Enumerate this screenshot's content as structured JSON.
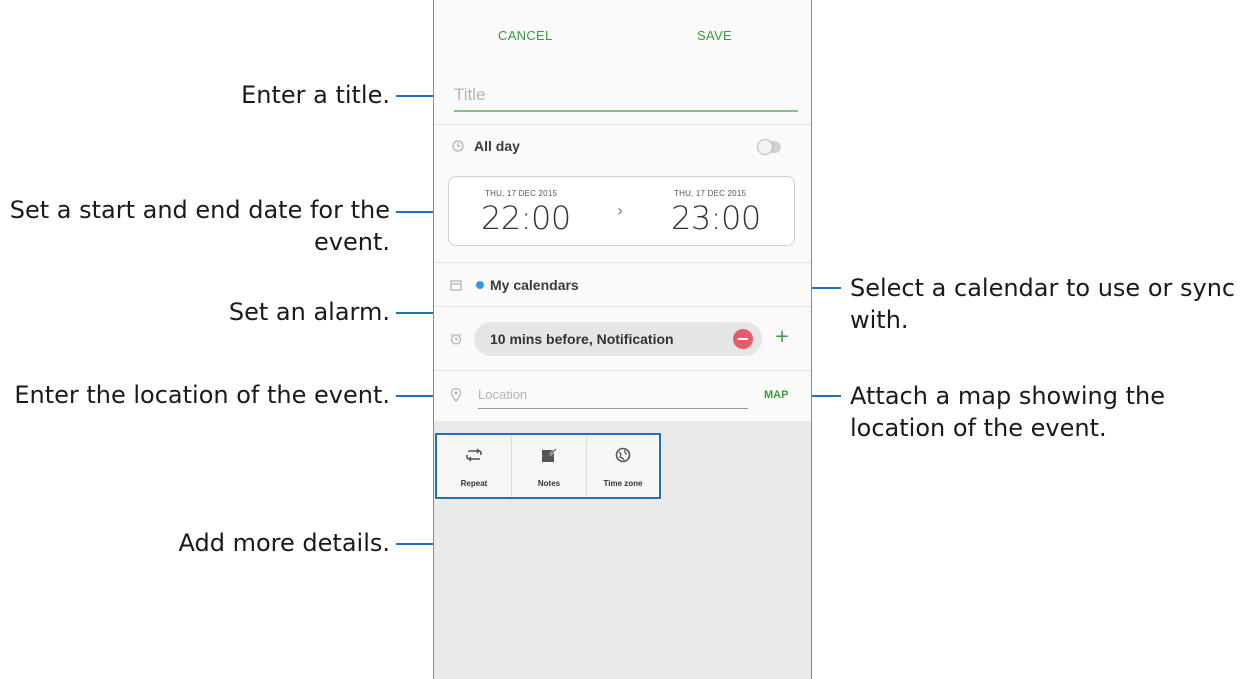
{
  "toolbar": {
    "cancel_label": "CANCEL",
    "save_label": "SAVE"
  },
  "event_form": {
    "title_placeholder": "Title",
    "all_day_label": "All day",
    "all_day_enabled": false,
    "start": {
      "date": "THU, 17 DEC 2015",
      "time": "22:00"
    },
    "end": {
      "date": "THU, 17 DEC 2015",
      "time": "23:00"
    },
    "date_arrow": "›",
    "calendar_label": "My calendars",
    "calendar_color": "#2f9be3",
    "alarm_label": "10 mins before, Notification",
    "alarm_remove_icon": "−",
    "alarm_add_icon": "+",
    "location_placeholder": "Location",
    "map_label": "MAP",
    "icons": {
      "all_day": "clock-icon",
      "calendar": "calendar-icon",
      "alarm": "alarm-clock-icon",
      "location": "location-pin-icon"
    }
  },
  "details": [
    {
      "label": "Repeat",
      "icon": "repeat-icon"
    },
    {
      "label": "Notes",
      "icon": "notes-icon"
    },
    {
      "label": "Time zone",
      "icon": "globe-icon"
    }
  ],
  "callouts": {
    "title": "Enter a title.",
    "dates_line1": "Set a start and end date for the",
    "dates_line2": "event.",
    "alarm": "Set an alarm.",
    "location": "Enter the location of the event.",
    "details": "Add more details.",
    "calendar_line1": "Select a calendar to use or sync",
    "calendar_line2": "with.",
    "map_line1": "Attach a map showing the",
    "map_line2": "location of the event."
  },
  "colors": {
    "accent_green": "#3c9a3c",
    "callout_line": "#1e73b8",
    "alarm_remove": "#e85a6a"
  }
}
